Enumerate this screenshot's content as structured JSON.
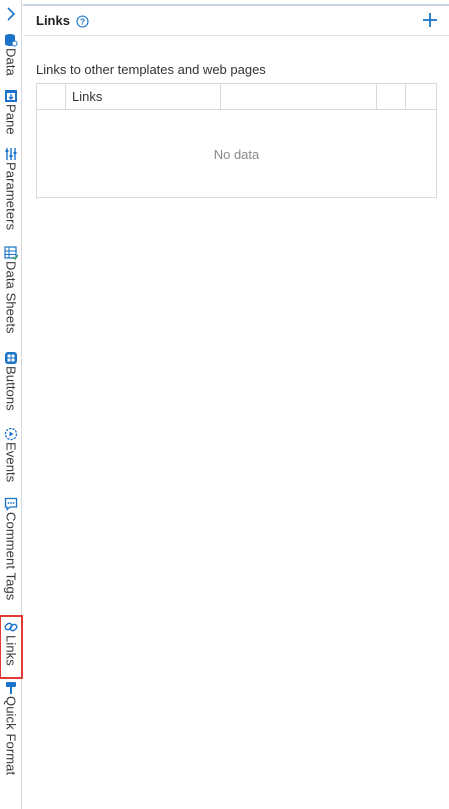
{
  "rail": {
    "toggle_icon": "chevron-right-icon",
    "tabs": [
      {
        "key": "data",
        "label": "Data",
        "icon": "database-icon"
      },
      {
        "key": "pane",
        "label": "Pane",
        "icon": "pane-icon"
      },
      {
        "key": "parameters",
        "label": "Parameters",
        "icon": "sliders-icon"
      },
      {
        "key": "data-sheets",
        "label": "Data Sheets",
        "icon": "table-icon"
      },
      {
        "key": "buttons",
        "label": "Buttons",
        "icon": "keypad-icon"
      },
      {
        "key": "events",
        "label": "Events",
        "icon": "play-gear-icon"
      },
      {
        "key": "comment-tags",
        "label": "Comment Tags",
        "icon": "comment-icon"
      },
      {
        "key": "links",
        "label": "Links",
        "icon": "link-icon",
        "active": true
      },
      {
        "key": "quick-format",
        "label": "Quick Format",
        "icon": "brush-icon"
      }
    ]
  },
  "panel": {
    "title": "Links",
    "help_icon": "help-icon",
    "add_icon": "plus-icon",
    "section_label": "Links to other templates and web pages",
    "grid": {
      "columns": [
        "",
        "Links",
        "",
        "",
        ""
      ],
      "empty_text": "No data"
    }
  },
  "colors": {
    "accent": "#1a73c9",
    "active_outline": "#e53935",
    "border": "#d9d9d9"
  }
}
